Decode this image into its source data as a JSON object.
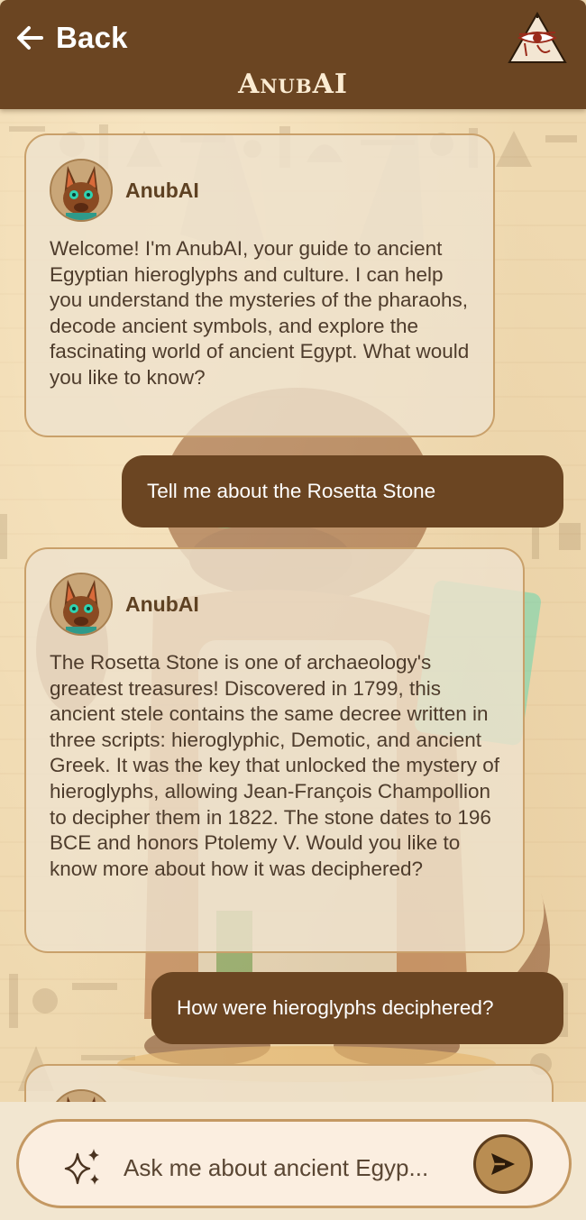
{
  "header": {
    "back_label": "Back",
    "title": "AnubAI"
  },
  "bot_name": "AnubAI",
  "messages": [
    {
      "role": "assistant",
      "sender": "AnubAI",
      "text": "Welcome! I'm AnubAI, your guide to ancient Egyptian hieroglyphs and culture. I can help you understand the mysteries of the pharaohs, decode ancient symbols, and explore the fascinating world of ancient Egypt. What would you like to know?"
    },
    {
      "role": "user",
      "text": "Tell me about the Rosetta Stone"
    },
    {
      "role": "assistant",
      "sender": "AnubAI",
      "text": "The Rosetta Stone is one of archaeology's greatest treasures! Discovered in 1799, this ancient stele contains the same decree written in three scripts: hieroglyphic, Demotic, and ancient Greek. It was the key that unlocked the mystery of hieroglyphs, allowing Jean-François Champollion to decipher them in 1822. The stone dates to 196 BCE and honors Ptolemy V. Would you like to know more about how it was deciphered?"
    },
    {
      "role": "user",
      "text": "How were hieroglyphs deciphered?"
    }
  ],
  "input": {
    "placeholder": "Ask me about ancient Egyp...",
    "value": ""
  },
  "icons": {
    "back": "arrow-left-icon",
    "logo": "eye-of-ra-pyramid-logo",
    "sparkle": "sparkle-icon",
    "send": "send-icon"
  },
  "colors": {
    "header_bg": "#6b4522",
    "user_bubble": "#6b4522",
    "bot_bubble": "#eee2cd",
    "bot_border": "#c9a06a",
    "send_button": "#b98d52"
  }
}
